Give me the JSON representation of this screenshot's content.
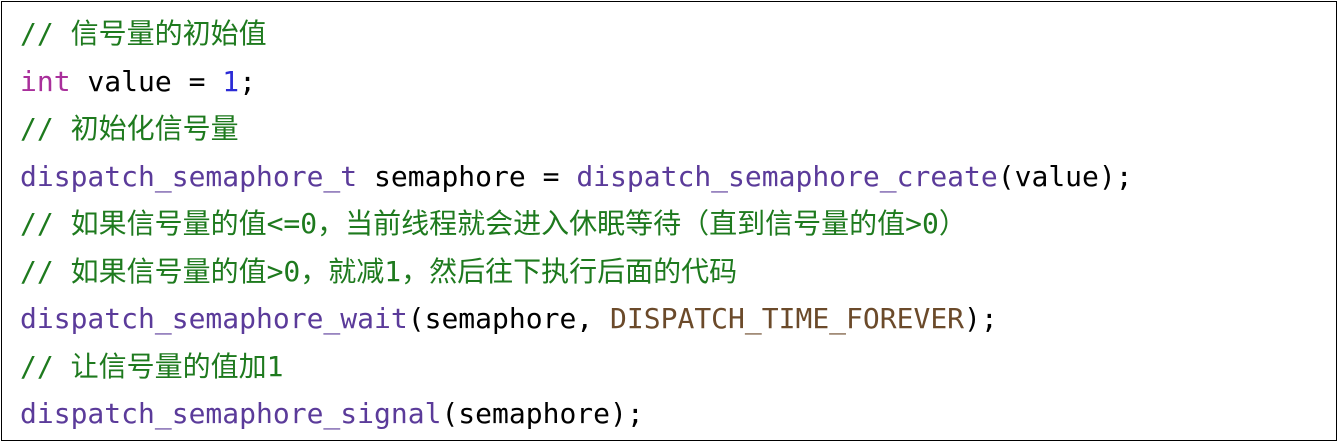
{
  "colors": {
    "comment": "#1e7a1e",
    "keyword": "#a92f9b",
    "number": "#2b2bd6",
    "function": "#5b3b9a",
    "constant": "#6b4a2a",
    "plain": "#000000",
    "border": "#000000",
    "background": "#ffffff"
  },
  "code": {
    "line1": {
      "comment": "// 信号量的初始值"
    },
    "line2": {
      "keyword": "int",
      "rest_a": " value = ",
      "number": "1",
      "rest_b": ";"
    },
    "line3": {
      "comment": "// 初始化信号量"
    },
    "line4": {
      "type": "dispatch_semaphore_t",
      "rest_a": " semaphore = ",
      "func": "dispatch_semaphore_create",
      "rest_b": "(value);"
    },
    "line5": {
      "comment": "// 如果信号量的值<=0，当前线程就会进入休眠等待（直到信号量的值>0）"
    },
    "line6": {
      "comment": "// 如果信号量的值>0，就减1，然后往下执行后面的代码"
    },
    "line7": {
      "func": "dispatch_semaphore_wait",
      "rest_a": "(semaphore, ",
      "constant": "DISPATCH_TIME_FOREVER",
      "rest_b": ");"
    },
    "line8": {
      "comment": "// 让信号量的值加1"
    },
    "line9": {
      "func": "dispatch_semaphore_signal",
      "rest_a": "(semaphore);"
    }
  }
}
